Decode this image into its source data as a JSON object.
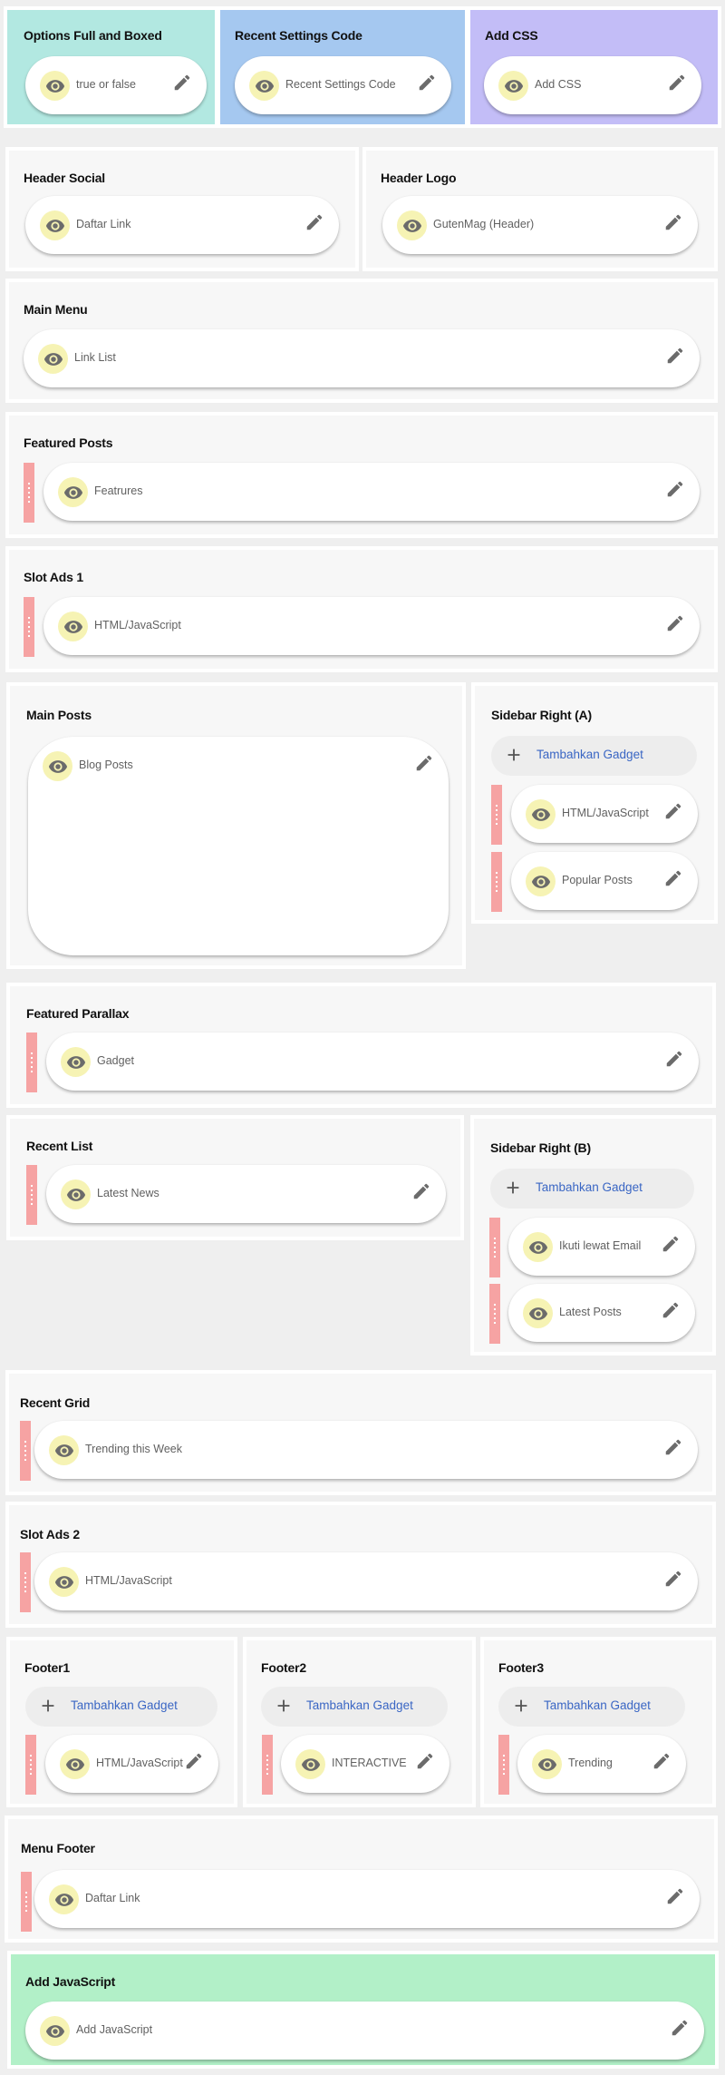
{
  "gadget_add_label": "Tambahkan Gadget",
  "colors": {
    "page_bg": "#efefef",
    "section_bg": "#f7f7f7",
    "teal": "#b2e8e1",
    "blue": "#a5c8f0",
    "purple": "#c3bdf7",
    "green": "#b2f0c8",
    "eye_bg": "#f6f3b4",
    "drag_handle": "#f6a3a3",
    "link_blue": "#3a66c4"
  },
  "icons": {
    "visibility": "eye-icon",
    "edit": "pencil-icon",
    "add": "plus-icon",
    "drag": "drag-handle-icon"
  },
  "sections": {
    "options": {
      "title": "Options Full and Boxed",
      "widgets": [
        {
          "label": "true or false"
        }
      ]
    },
    "recent_settings": {
      "title": "Recent Settings Code",
      "widgets": [
        {
          "label": "Recent Settings Code"
        }
      ]
    },
    "add_css": {
      "title": "Add CSS",
      "widgets": [
        {
          "label": "Add CSS"
        }
      ]
    },
    "header_social": {
      "title": "Header Social",
      "widgets": [
        {
          "label": "Daftar Link"
        }
      ]
    },
    "header_logo": {
      "title": "Header Logo",
      "widgets": [
        {
          "label": "GutenMag (Header)"
        }
      ]
    },
    "main_menu": {
      "title": "Main Menu",
      "widgets": [
        {
          "label": "Link List"
        }
      ]
    },
    "featured_posts": {
      "title": "Featured Posts",
      "widgets": [
        {
          "label": "Featrures"
        }
      ]
    },
    "slot_ads_1": {
      "title": "Slot Ads 1",
      "widgets": [
        {
          "label": "HTML/JavaScript"
        }
      ]
    },
    "main_posts": {
      "title": "Main Posts",
      "widgets": [
        {
          "label": "Blog Posts"
        }
      ]
    },
    "sidebar_a": {
      "title": "Sidebar Right (A)",
      "widgets": [
        {
          "label": "HTML/JavaScript"
        },
        {
          "label": "Popular Posts"
        }
      ]
    },
    "featured_parallax": {
      "title": "Featured Parallax",
      "widgets": [
        {
          "label": "Gadget"
        }
      ]
    },
    "recent_list": {
      "title": "Recent List",
      "widgets": [
        {
          "label": "Latest News"
        }
      ]
    },
    "sidebar_b": {
      "title": "Sidebar Right (B)",
      "widgets": [
        {
          "label": "Ikuti lewat Email"
        },
        {
          "label": "Latest Posts"
        }
      ]
    },
    "recent_grid": {
      "title": "Recent Grid",
      "widgets": [
        {
          "label": "Trending this Week"
        }
      ]
    },
    "slot_ads_2": {
      "title": "Slot Ads 2",
      "widgets": [
        {
          "label": "HTML/JavaScript"
        }
      ]
    },
    "footer1": {
      "title": "Footer1",
      "widgets": [
        {
          "label": "HTML/JavaScript"
        }
      ]
    },
    "footer2": {
      "title": "Footer2",
      "widgets": [
        {
          "label": "INTERACTIVE"
        }
      ]
    },
    "footer3": {
      "title": "Footer3",
      "widgets": [
        {
          "label": "Trending"
        }
      ]
    },
    "menu_footer": {
      "title": "Menu Footer",
      "widgets": [
        {
          "label": "Daftar Link"
        }
      ]
    },
    "add_javascript": {
      "title": "Add JavaScript",
      "widgets": [
        {
          "label": "Add JavaScript"
        }
      ]
    }
  }
}
